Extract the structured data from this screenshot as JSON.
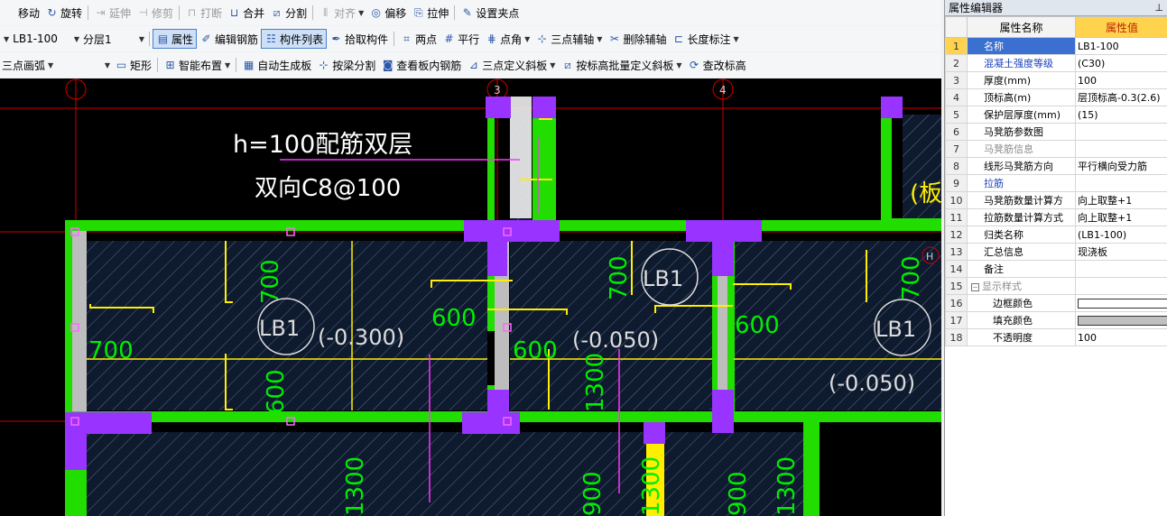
{
  "toolbar1": {
    "items": [
      {
        "label": "移动",
        "icon": "move-icon",
        "disabled": false
      },
      {
        "label": "旋转",
        "icon": "rotate-icon",
        "disabled": false
      },
      {
        "label": "延伸",
        "icon": "extend-icon",
        "disabled": true
      },
      {
        "label": "修剪",
        "icon": "trim-icon",
        "disabled": true
      },
      {
        "label": "打断",
        "icon": "break-icon",
        "disabled": true
      },
      {
        "label": "合并",
        "icon": "merge-icon",
        "disabled": false
      },
      {
        "label": "分割",
        "icon": "split-icon",
        "disabled": false
      },
      {
        "label": "对齐",
        "icon": "align-icon",
        "disabled": true
      },
      {
        "label": "偏移",
        "icon": "offset-icon",
        "disabled": false
      },
      {
        "label": "拉伸",
        "icon": "stretch-icon",
        "disabled": false
      },
      {
        "label": "设置夹点",
        "icon": "grip-icon",
        "disabled": false
      }
    ]
  },
  "toolbar2": {
    "component_select": "LB1-100",
    "layer_select": "分层1",
    "items": [
      {
        "label": "属性",
        "icon": "properties-icon",
        "active": true
      },
      {
        "label": "编辑钢筋",
        "icon": "edit-rebar-icon",
        "active": false
      },
      {
        "label": "构件列表",
        "icon": "component-list-icon",
        "active": true
      },
      {
        "label": "拾取构件",
        "icon": "pick-component-icon",
        "active": false
      },
      {
        "label": "两点",
        "icon": "two-point-icon",
        "active": false
      },
      {
        "label": "平行",
        "icon": "parallel-icon",
        "active": false
      },
      {
        "label": "点角",
        "icon": "point-angle-icon",
        "active": false
      },
      {
        "label": "三点辅轴",
        "icon": "three-point-axis-icon",
        "active": false
      },
      {
        "label": "删除辅轴",
        "icon": "delete-axis-icon",
        "active": false
      },
      {
        "label": "长度标注",
        "icon": "length-dim-icon",
        "active": false
      }
    ]
  },
  "toolbar3": {
    "arc_select": "三点画弧",
    "items": [
      {
        "label": "矩形",
        "icon": "rectangle-icon"
      },
      {
        "label": "智能布置",
        "icon": "smart-layout-icon"
      },
      {
        "label": "自动生成板",
        "icon": "auto-slab-icon"
      },
      {
        "label": "按梁分割",
        "icon": "beam-split-icon"
      },
      {
        "label": "查看板内钢筋",
        "icon": "view-rebar-icon"
      },
      {
        "label": "三点定义斜板",
        "icon": "three-point-slope-icon"
      },
      {
        "label": "按标高批量定义斜板",
        "icon": "batch-slope-icon"
      },
      {
        "label": "查改标高",
        "icon": "edit-elevation-icon"
      }
    ]
  },
  "canvas": {
    "note_line1": "h=100配筋双层",
    "note_line2": "双向C8@100",
    "axis_labels": [
      "3",
      "4"
    ],
    "slabs": [
      {
        "name": "LB1",
        "elevation": "(-0.300)"
      },
      {
        "name": "LB1",
        "elevation": "(-0.050)"
      },
      {
        "name": "LB1",
        "elevation": "(-0.050)"
      }
    ],
    "rebar_dims": [
      "700",
      "700",
      "600",
      "600",
      "600",
      "700",
      "600",
      "700",
      "1300",
      "1300",
      "1300",
      "900",
      "900",
      "1300"
    ],
    "side_label": "(板",
    "side_axis": "H"
  },
  "panel": {
    "title": "属性编辑器",
    "pin_icon": "pin-icon",
    "header_name": "属性名称",
    "header_value": "属性值",
    "rows": [
      {
        "num": "1",
        "name": "名称",
        "value": "LB1-100"
      },
      {
        "num": "2",
        "name": "混凝土强度等级",
        "value": "(C30)"
      },
      {
        "num": "3",
        "name": "厚度(mm)",
        "value": "100"
      },
      {
        "num": "4",
        "name": "顶标高(m)",
        "value": "层顶标高-0.3(2.6)"
      },
      {
        "num": "5",
        "name": "保护层厚度(mm)",
        "value": "(15)"
      },
      {
        "num": "6",
        "name": "马凳筋参数图",
        "value": ""
      },
      {
        "num": "7",
        "name": "马凳筋信息",
        "value": ""
      },
      {
        "num": "8",
        "name": "线形马凳筋方向",
        "value": "平行横向受力筋"
      },
      {
        "num": "9",
        "name": "拉筋",
        "value": ""
      },
      {
        "num": "10",
        "name": "马凳筋数量计算方",
        "value": "向上取整+1"
      },
      {
        "num": "11",
        "name": "拉筋数量计算方式",
        "value": "向上取整+1"
      },
      {
        "num": "12",
        "name": "归类名称",
        "value": "(LB1-100)"
      },
      {
        "num": "13",
        "name": "汇总信息",
        "value": "现浇板"
      },
      {
        "num": "14",
        "name": "备注",
        "value": ""
      },
      {
        "num": "15",
        "name": "显示样式",
        "value": ""
      },
      {
        "num": "16",
        "name": "边框颜色",
        "value": ""
      },
      {
        "num": "17",
        "name": "填充颜色",
        "value": ""
      },
      {
        "num": "18",
        "name": "不透明度",
        "value": "100"
      }
    ]
  },
  "colors": {
    "beam": "#22dd00",
    "column": "#9933ff",
    "rebar": "#ffee00",
    "dim_text": "#00ee00",
    "axis": "#cc0000",
    "fill_color": "#c0c0c0",
    "border_color": "#ffffff"
  }
}
